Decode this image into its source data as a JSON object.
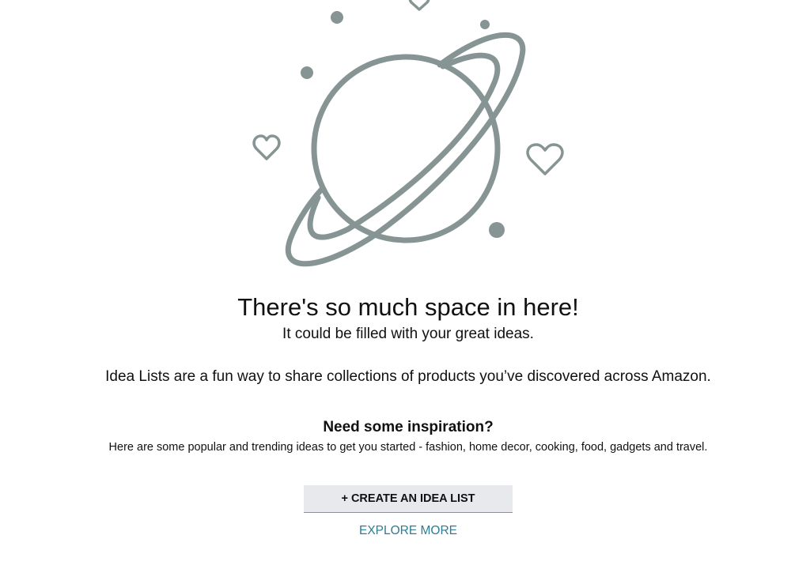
{
  "empty_state": {
    "headline": "There's so much space in here!",
    "subline": "It could be filled with your great ideas.",
    "description": "Idea Lists are a fun way to share collections of products you’ve discovered across Amazon.",
    "inspiration_title": "Need some inspiration?",
    "inspiration_body": "Here are some popular and trending ideas to get you started - fashion, home decor, cooking, food, gadgets and travel."
  },
  "actions": {
    "create_label": "+ CREATE AN IDEA LIST",
    "explore_label": "EXPLORE MORE"
  },
  "illustration": {
    "icons": [
      "planet-icon",
      "heart-icon",
      "dot-icon"
    ],
    "stroke_color": "#879494"
  },
  "colors": {
    "link": "#2e7d95",
    "button_bg": "#e7e9ec",
    "text": "#111111"
  }
}
